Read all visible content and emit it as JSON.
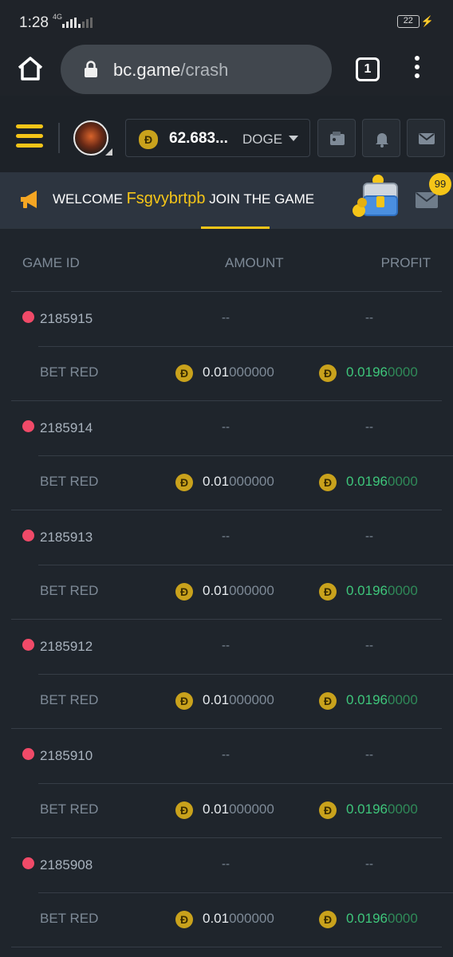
{
  "status_bar": {
    "time": "1:28",
    "network": "4G",
    "battery": "22"
  },
  "browser": {
    "url_host": "bc.game",
    "url_path": "/crash",
    "tab_count": "1"
  },
  "header": {
    "balance": "62.683...",
    "currency": "DOGE",
    "coin_symbol": "Ð"
  },
  "banner": {
    "prefix": "WELCOME ",
    "username": "Fsgvybrtpb",
    "suffix": " JOIN THE GAME",
    "badge": "99"
  },
  "table": {
    "columns": {
      "game_id": "GAME ID",
      "amount": "AMOUNT",
      "profit": "PROFIT"
    },
    "empty": "--",
    "rows": [
      {
        "game_id": "2185915",
        "bet": "BET RED",
        "amount_hi": "0.01",
        "amount_lo": "000000",
        "profit_hi": "0.0196",
        "profit_lo": "0000"
      },
      {
        "game_id": "2185914",
        "bet": "BET RED",
        "amount_hi": "0.01",
        "amount_lo": "000000",
        "profit_hi": "0.0196",
        "profit_lo": "0000"
      },
      {
        "game_id": "2185913",
        "bet": "BET RED",
        "amount_hi": "0.01",
        "amount_lo": "000000",
        "profit_hi": "0.0196",
        "profit_lo": "0000"
      },
      {
        "game_id": "2185912",
        "bet": "BET RED",
        "amount_hi": "0.01",
        "amount_lo": "000000",
        "profit_hi": "0.0196",
        "profit_lo": "0000"
      },
      {
        "game_id": "2185910",
        "bet": "BET RED",
        "amount_hi": "0.01",
        "amount_lo": "000000",
        "profit_hi": "0.0196",
        "profit_lo": "0000"
      },
      {
        "game_id": "2185908",
        "bet": "BET RED",
        "amount_hi": "0.01",
        "amount_lo": "000000",
        "profit_hi": "0.0196",
        "profit_lo": "0000"
      }
    ]
  },
  "colors": {
    "accent": "#f5c518",
    "profit": "#3ec77b",
    "lose_dot": "#f04a68",
    "background": "#1f252c"
  }
}
